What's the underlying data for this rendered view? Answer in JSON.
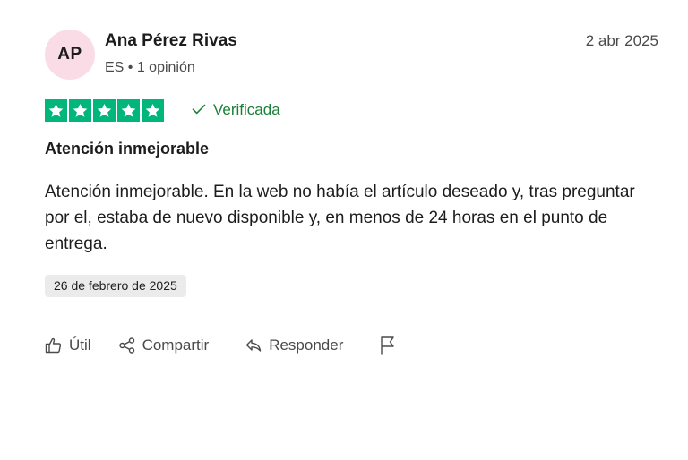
{
  "author": {
    "initials": "AP",
    "name": "Ana Pérez Rivas",
    "meta": "ES • 1 opinión"
  },
  "review": {
    "date": "2 abr 2025",
    "rating": 5,
    "rating_max": 5,
    "verified_label": "Verificada",
    "title": "Atención inmejorable",
    "body": "Atención inmejorable. En la web no había el artículo deseado y, tras preguntar por el, estaba de nuevo disponible y, en menos de 24 horas en el punto de entrega.",
    "experience_date": "26 de febrero de 2025"
  },
  "actions": {
    "helpful_label": "Útil",
    "share_label": "Compartir",
    "reply_label": "Responder",
    "report_icon": "flag-icon"
  },
  "colors": {
    "star_bg": "#00b67a",
    "verified": "#1a7f37",
    "avatar_bg": "#fadce6"
  }
}
